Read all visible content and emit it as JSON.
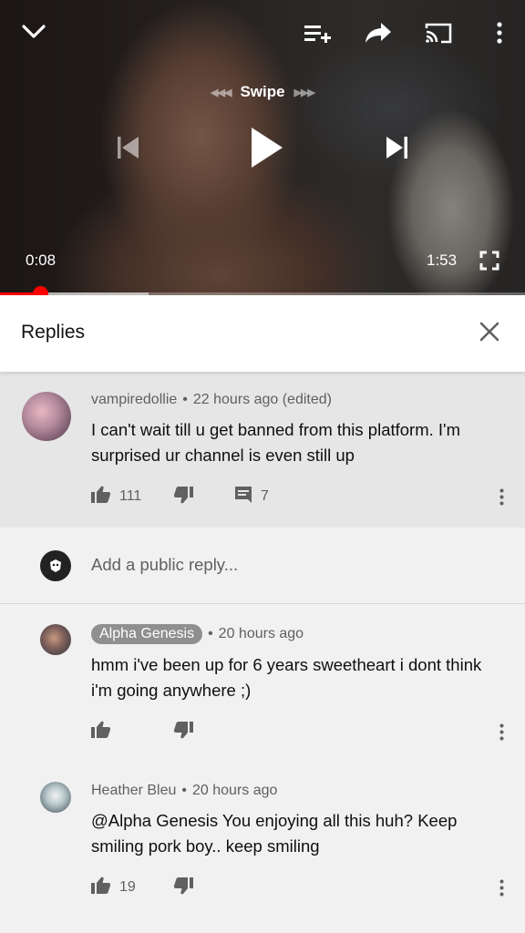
{
  "player": {
    "swipe_label": "Swipe",
    "current_time": "0:08",
    "duration": "1:53",
    "progress_played": 0.077,
    "progress_buffered": 0.283,
    "accent_color": "#ff0000",
    "icons": [
      "chevron-down-icon",
      "add-to-queue-icon",
      "share-icon",
      "cast-icon",
      "more-vert-icon",
      "skip-previous-icon",
      "play-icon",
      "skip-next-icon",
      "fullscreen-icon"
    ]
  },
  "replies_panel": {
    "title": "Replies",
    "close_icon": "close-icon"
  },
  "parent_comment": {
    "author": "vampiredollie",
    "time": "22 hours ago (edited)",
    "text": "I can't wait till u get banned from this platform. I'm surprised ur channel is even still up",
    "likes": "111",
    "replies": "7"
  },
  "add_reply": {
    "placeholder": "Add a public reply..."
  },
  "replies": [
    {
      "author": "Alpha Genesis",
      "time": "20 hours ago",
      "text": "hmm i've been up for 6 years sweetheart i dont think i'm going anywhere ;)",
      "likes": ""
    },
    {
      "author": "Heather Bleu",
      "time": "20 hours ago",
      "text": "@Alpha Genesis You enjoying all this huh? Keep smiling pork boy.. keep smiling",
      "likes": "19"
    }
  ]
}
